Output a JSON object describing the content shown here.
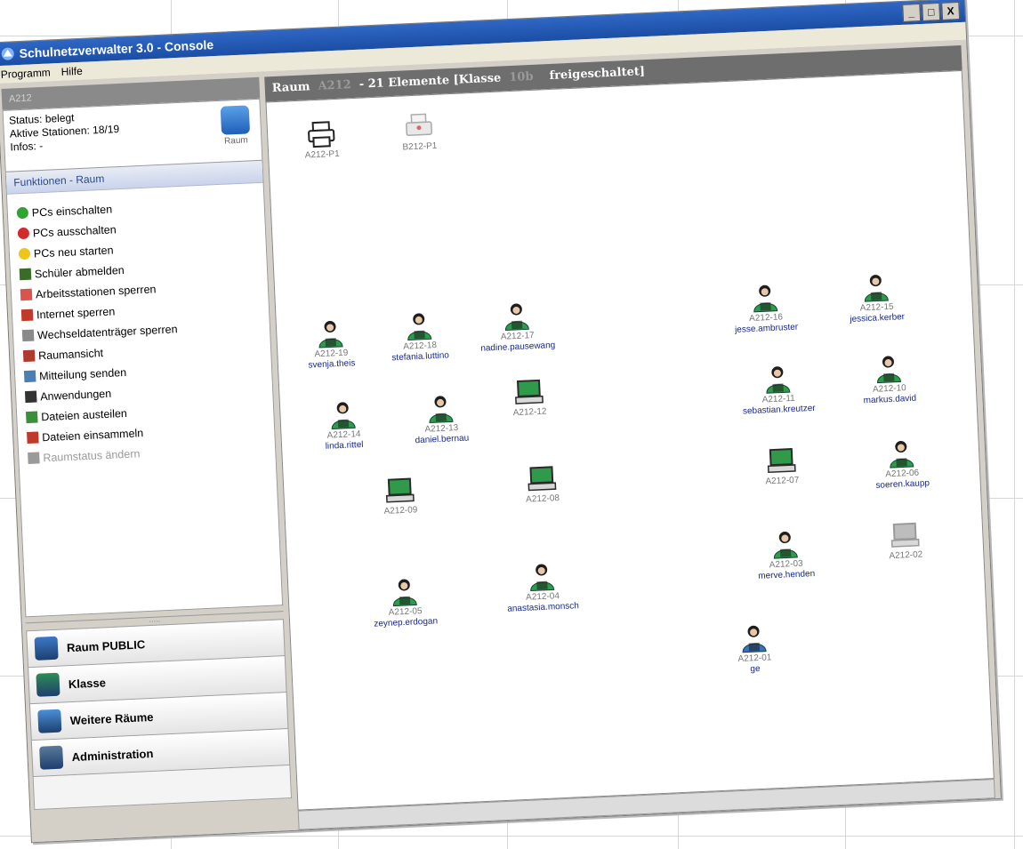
{
  "app": {
    "title": "Schulnetzverwalter 3.0 - Console",
    "window_buttons": [
      "_",
      "□",
      "X"
    ]
  },
  "menu": [
    "Programm",
    "Hilfe"
  ],
  "left": {
    "selected_room": "A212",
    "status": {
      "status_line": "Status: belegt",
      "stations_line": "Aktive Stationen: 18/19",
      "infos_line": "Infos: -",
      "icon_label": "Raum"
    },
    "functions_header": "Funktionen - Raum",
    "functions": [
      {
        "label": "PCs einschalten",
        "icon": "power-on-icon",
        "color": "#2fa52f"
      },
      {
        "label": "PCs ausschalten",
        "icon": "power-off-icon",
        "color": "#d22b2b"
      },
      {
        "label": "PCs neu starten",
        "icon": "restart-icon",
        "color": "#f0c419"
      },
      {
        "label": "Schüler abmelden",
        "icon": "logoff-user-icon",
        "color": "#3a6b2a"
      },
      {
        "label": "Arbeitsstationen sperren",
        "icon": "lock-stations-icon",
        "color": "#d9534f"
      },
      {
        "label": "Internet sperren",
        "icon": "lock-internet-icon",
        "color": "#c0392b"
      },
      {
        "label": "Wechseldatenträger sperren",
        "icon": "lock-drive-icon",
        "color": "#8a8a8a"
      },
      {
        "label": "Raumansicht",
        "icon": "room-view-icon",
        "color": "#b03a2e"
      },
      {
        "label": "Mitteilung senden",
        "icon": "send-message-icon",
        "color": "#4a7fb5"
      },
      {
        "label": "Anwendungen",
        "icon": "applications-icon",
        "color": "#333333"
      },
      {
        "label": "Dateien austeilen",
        "icon": "distribute-files-icon",
        "color": "#3a8f3a"
      },
      {
        "label": "Dateien einsammeln",
        "icon": "collect-files-icon",
        "color": "#c0392b"
      },
      {
        "label": "Raumstatus ändern",
        "icon": "change-room-status-icon",
        "color": "#9a9a9a",
        "disabled": true
      }
    ],
    "nav": [
      {
        "label": "Raum PUBLIC",
        "icon": "room-public-icon",
        "color": "#3b78c8"
      },
      {
        "label": "Klasse",
        "icon": "class-icon",
        "color": "#2e8b57"
      },
      {
        "label": "Weitere Räume",
        "icon": "more-rooms-icon",
        "color": "#4a90d9"
      },
      {
        "label": "Administration",
        "icon": "administration-icon",
        "color": "#5a7a9a"
      }
    ]
  },
  "room": {
    "header_prefix": "Raum",
    "room_name": "A212",
    "header_mid": "- 21 Elemente [Klasse",
    "class_name": "10b",
    "header_suffix": "freigeschaltet]",
    "printers": [
      {
        "id": "A212-P1",
        "state": "active"
      },
      {
        "id": "B212-P1",
        "state": "inactive"
      }
    ],
    "stations": [
      {
        "id": "A212-19",
        "user": "svenja.theis",
        "type": "user"
      },
      {
        "id": "A212-18",
        "user": "stefania.luttino",
        "type": "user"
      },
      {
        "id": "A212-17",
        "user": "nadine.pausewang",
        "type": "user"
      },
      {
        "id": "A212-16",
        "user": "jesse.ambruster",
        "type": "user"
      },
      {
        "id": "A212-15",
        "user": "jessica.kerber",
        "type": "user"
      },
      {
        "id": "A212-14",
        "user": "linda.rittel",
        "type": "user"
      },
      {
        "id": "A212-13",
        "user": "daniel.bernau",
        "type": "user"
      },
      {
        "id": "A212-12",
        "user": "",
        "type": "pc"
      },
      {
        "id": "A212-11",
        "user": "sebastian.kreutzer",
        "type": "user"
      },
      {
        "id": "A212-10",
        "user": "markus.david",
        "type": "user"
      },
      {
        "id": "A212-09",
        "user": "",
        "type": "pc"
      },
      {
        "id": "A212-08",
        "user": "",
        "type": "pc"
      },
      {
        "id": "A212-07",
        "user": "",
        "type": "pc"
      },
      {
        "id": "A212-06",
        "user": "soeren.kaupp",
        "type": "user"
      },
      {
        "id": "A212-02",
        "user": "",
        "type": "pc-off"
      },
      {
        "id": "A212-05",
        "user": "zeynep.erdogan",
        "type": "user"
      },
      {
        "id": "A212-04",
        "user": "anastasia.monsch",
        "type": "user"
      },
      {
        "id": "A212-03",
        "user": "merve.henden",
        "type": "user"
      },
      {
        "id": "A212-01",
        "user": "ge",
        "type": "teacher"
      }
    ]
  },
  "colors": {
    "titlebar": "#1b4ea5",
    "user_green": "#2e9a4a",
    "teacher_blue": "#3a6fc4",
    "user_text": "#1a2a88"
  }
}
